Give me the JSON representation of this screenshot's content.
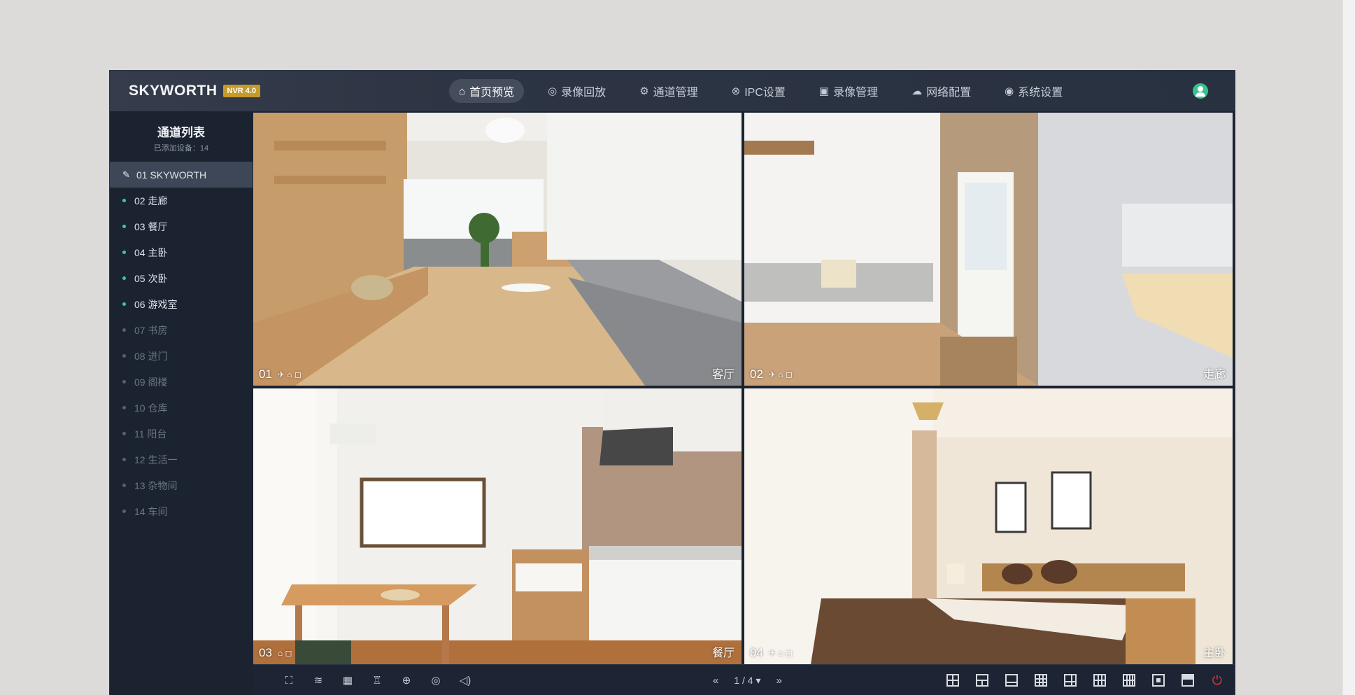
{
  "brand": {
    "name": "SKYWORTH",
    "badge": "NVR 4.0"
  },
  "nav": {
    "items": [
      {
        "label": "首页预览",
        "icon": "home-icon"
      },
      {
        "label": "录像回放",
        "icon": "playback-icon"
      },
      {
        "label": "通道管理",
        "icon": "channel-icon"
      },
      {
        "label": "IPC设置",
        "icon": "ipc-icon"
      },
      {
        "label": "录像管理",
        "icon": "record-icon"
      },
      {
        "label": "网络配置",
        "icon": "network-icon"
      },
      {
        "label": "系统设置",
        "icon": "settings-icon"
      }
    ],
    "active": "首页预览"
  },
  "sidebar": {
    "title": "通道列表",
    "subtitle": "已添加设备：14",
    "channels": [
      {
        "label": "01 SKYWORTH",
        "status": "selected"
      },
      {
        "label": "02 走廊",
        "status": "online"
      },
      {
        "label": "03 餐厅",
        "status": "online"
      },
      {
        "label": "04 主卧",
        "status": "online"
      },
      {
        "label": "05 次卧",
        "status": "online"
      },
      {
        "label": "06 游戏室",
        "status": "online"
      },
      {
        "label": "07 书房",
        "status": "offline"
      },
      {
        "label": "08 进门",
        "status": "offline"
      },
      {
        "label": "09 阁楼",
        "status": "offline"
      },
      {
        "label": "10 仓库",
        "status": "offline"
      },
      {
        "label": "11 阳台",
        "status": "offline"
      },
      {
        "label": "12 生活一",
        "status": "offline"
      },
      {
        "label": "13 杂物间",
        "status": "offline"
      },
      {
        "label": "14 车间",
        "status": "offline"
      }
    ]
  },
  "cameras": [
    {
      "id": "01",
      "name": "客厅",
      "scene": "living-room"
    },
    {
      "id": "02",
      "name": "走廊",
      "scene": "corridor"
    },
    {
      "id": "03",
      "name": "餐厅",
      "scene": "kitchen"
    },
    {
      "id": "04",
      "name": "主卧",
      "scene": "bedroom"
    }
  ],
  "toolbar": {
    "pager": {
      "prev": "«",
      "current": "1 / 4 ▾",
      "next": "»"
    },
    "tools": [
      "fullscreen-icon",
      "adjust-icon",
      "qr-icon",
      "alarm-icon",
      "zoom-icon",
      "ptz-icon",
      "volume-icon"
    ],
    "layouts": [
      "layout-4-icon",
      "layout-2-icon",
      "layout-1plus-icon",
      "layout-9-icon",
      "layout-6-icon",
      "layout-8-icon",
      "layout-16-icon",
      "layout-1-icon",
      "layout-full-icon"
    ]
  },
  "colors": {
    "online": "#2fd296",
    "brand_badge": "#c59a2a",
    "power": "#e53935",
    "bg": "#1b2331"
  }
}
